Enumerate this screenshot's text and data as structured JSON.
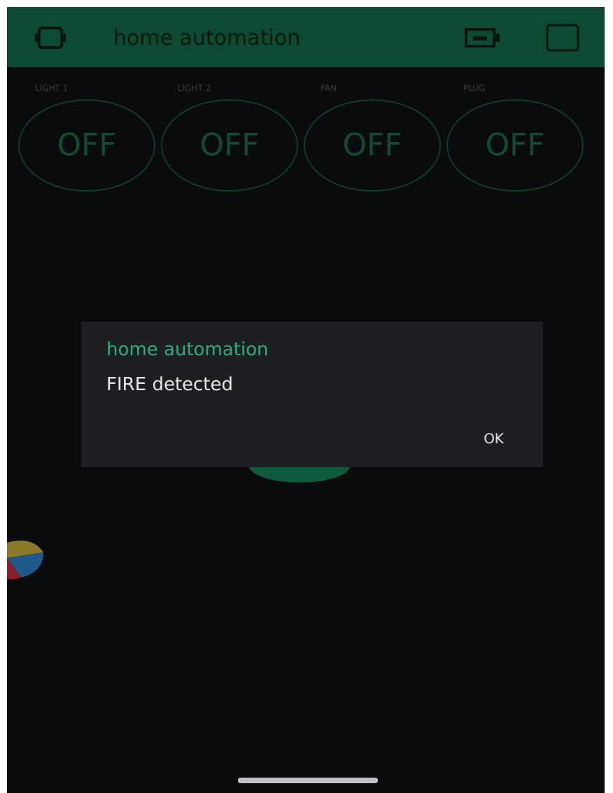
{
  "header": {
    "title": "home automation"
  },
  "switches": [
    {
      "label": "LIGHT 1",
      "value": "OFF",
      "on": false
    },
    {
      "label": "LIGHT 2",
      "value": "OFF",
      "on": false
    },
    {
      "label": "FAN",
      "value": "OFF",
      "on": false
    },
    {
      "label": "PLUG",
      "value": "OFF",
      "on": false
    }
  ],
  "dialog": {
    "title": "home automation",
    "message": "FIRE detected",
    "buttons": [
      "OK"
    ]
  }
}
